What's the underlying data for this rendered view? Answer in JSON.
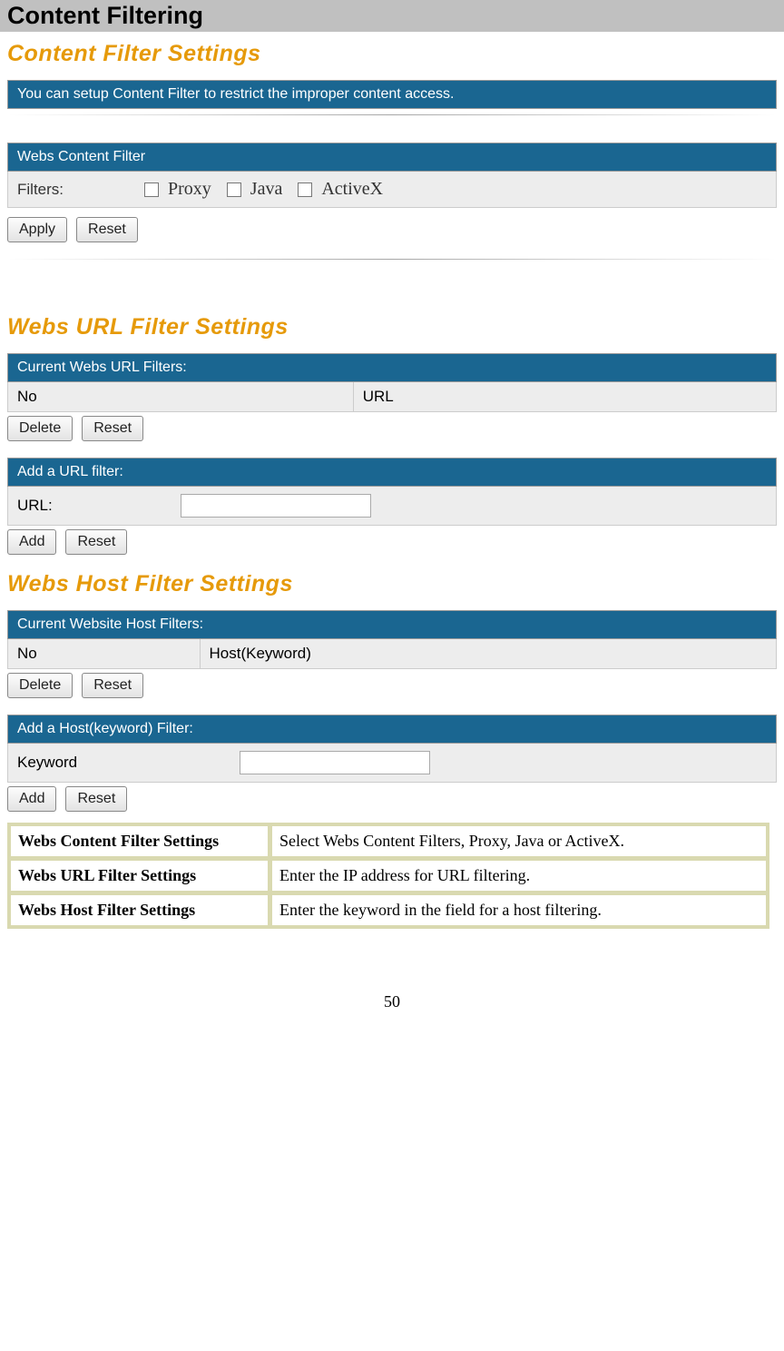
{
  "page_heading": "Content Filtering",
  "section1": {
    "title": "Content Filter Settings",
    "desc": "You can setup Content Filter to restrict the improper content access.",
    "panel_title": "Webs Content Filter",
    "filters_label": "Filters:",
    "opts": {
      "proxy": "Proxy",
      "java": "Java",
      "activex": "ActiveX"
    },
    "apply": "Apply",
    "reset": "Reset"
  },
  "section2": {
    "title": "Webs URL Filter Settings",
    "panel_current": "Current Webs URL Filters:",
    "col_no": "No",
    "col_url": "URL",
    "delete": "Delete",
    "reset": "Reset",
    "panel_add": "Add a URL filter:",
    "url_label": "URL:",
    "add": "Add"
  },
  "section3": {
    "title": "Webs Host Filter Settings",
    "panel_current": "Current Website Host Filters:",
    "col_no": "No",
    "col_host": "Host(Keyword)",
    "delete": "Delete",
    "reset": "Reset",
    "panel_add": "Add a Host(keyword) Filter:",
    "keyword_label": "Keyword",
    "add": "Add"
  },
  "desc_table": {
    "r1k": "Webs Content Filter Settings",
    "r1v": "Select Webs Content Filters, Proxy, Java or ActiveX.",
    "r2k": "Webs URL Filter Settings",
    "r2v": "Enter the IP address for URL filtering.",
    "r3k": "Webs Host Filter Settings",
    "r3v": "Enter the keyword in the field for a host filtering."
  },
  "page_number": "50"
}
